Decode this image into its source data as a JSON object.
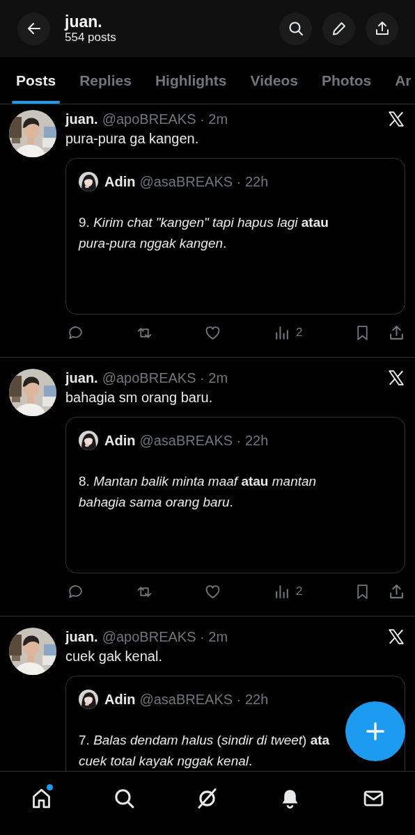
{
  "header": {
    "title": "juan.",
    "subtitle": "554 posts",
    "actions": [
      {
        "kind": "search"
      },
      {
        "kind": "edit"
      },
      {
        "kind": "share"
      }
    ]
  },
  "tabs": [
    {
      "label": "Posts",
      "selected": true
    },
    {
      "label": "Replies",
      "selected": false
    },
    {
      "label": "Highlights",
      "selected": false
    },
    {
      "label": "Videos",
      "selected": false
    },
    {
      "label": "Photos",
      "selected": false
    },
    {
      "label": "Ar",
      "selected": false
    }
  ],
  "posts": [
    {
      "author": "juan.",
      "handle": "@apoBREAKS · 2m",
      "text": "pura-pura ga kangen.",
      "quote": {
        "author": "Adin",
        "handle": "@asaBREAKS · 22h",
        "lines": [
          "9. *Kirim chat \"kangen\" tapi hapus lagi* **atau**",
          "*pura-pura nggak kangen*."
        ]
      },
      "actions": [
        {
          "kind": "reply"
        },
        {
          "kind": "repost"
        },
        {
          "kind": "like"
        },
        {
          "kind": "views",
          "count": "2"
        },
        {
          "kind": "bookmark"
        },
        {
          "kind": "share"
        }
      ]
    },
    {
      "author": "juan.",
      "handle": "@apoBREAKS · 2m",
      "text": "bahagia sm orang baru.",
      "quote": {
        "author": "Adin",
        "handle": "@asaBREAKS · 22h",
        "lines": [
          "8. *Mantan balik minta maaf* **atau** *mantan*",
          "*bahagia sama orang baru*."
        ]
      },
      "actions": [
        {
          "kind": "reply"
        },
        {
          "kind": "repost"
        },
        {
          "kind": "like"
        },
        {
          "kind": "views",
          "count": "2"
        },
        {
          "kind": "bookmark"
        },
        {
          "kind": "share"
        }
      ]
    },
    {
      "author": "juan.",
      "handle": "@apoBREAKS · 2m",
      "text": "cuek gak kenal.",
      "quote": {
        "author": "Adin",
        "handle": "@asaBREAKS · 22h",
        "lines": [
          "7. *Balas dendam halus* (*sindir di tweet*) **ata**",
          "*cuek total kayak nggak kenal*."
        ]
      }
    }
  ],
  "bottom_nav": [
    {
      "kind": "home",
      "dot": true
    },
    {
      "kind": "search",
      "dot": false
    },
    {
      "kind": "grok",
      "dot": false
    },
    {
      "kind": "notifications",
      "dot": false
    },
    {
      "kind": "messages",
      "dot": false
    }
  ]
}
